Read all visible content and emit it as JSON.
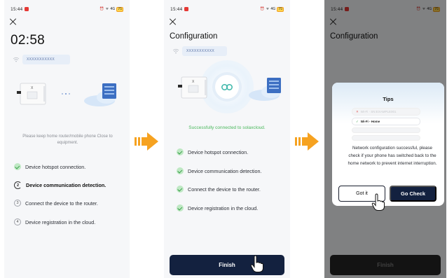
{
  "status_bar": {
    "time": "15:44",
    "network": "4G",
    "battery": "75"
  },
  "screen1": {
    "timer": "02:58",
    "ssid": "XXXXXXXXXXX",
    "hint": "Please keep home router/mobile phone Close to equipment.",
    "steps": [
      {
        "num": "",
        "label": "Device hotspot connection.",
        "state": "done"
      },
      {
        "num": "2",
        "label": "Device communication detection.",
        "state": "active"
      },
      {
        "num": "3",
        "label": "Connect the device to the router.",
        "state": "pending"
      },
      {
        "num": "4",
        "label": "Device registration in the cloud.",
        "state": "pending"
      }
    ]
  },
  "screen2": {
    "title": "Configuration",
    "ssid": "XXXXXXXXXXX",
    "success": "Successfully connected to solaxcloud.",
    "steps": [
      {
        "label": "Device hotspot connection."
      },
      {
        "label": "Device communication detection."
      },
      {
        "label": "Connect the device to the router."
      },
      {
        "label": "Device registration in the cloud."
      }
    ],
    "finish_label": "Finish"
  },
  "screen3": {
    "title": "Configuration",
    "finish_label": "Finish",
    "dialog": {
      "title": "Tips",
      "wifi_row_top": "Wi-Fi · SN:EXAMPLE001",
      "wifi_row_main": "Wi-Fi - Home",
      "message": "Network configuration successful, please check if your phone has switched back to the home network to prevent internet interruption.",
      "got_it": "Got it",
      "go_check": "Go Check"
    }
  },
  "colors": {
    "accent_navy": "#13213f",
    "success_green": "#4ab85c",
    "arrow_orange": "#f6a220"
  }
}
